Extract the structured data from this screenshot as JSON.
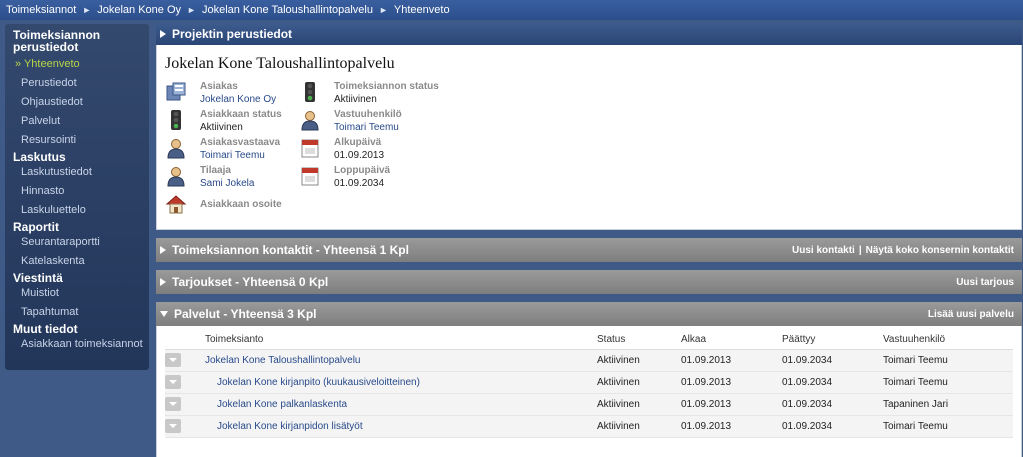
{
  "breadcrumb": [
    "Toimeksiannot",
    "Jokelan Kone Oy",
    "Jokelan Kone Taloushallintopalvelu",
    "Yhteenveto"
  ],
  "sidebar": {
    "sections": [
      {
        "title": "Toimeksiannon perustiedot",
        "items": [
          {
            "label": "» Yhteenveto",
            "active": true
          },
          {
            "label": "Perustiedot"
          },
          {
            "label": "Ohjaustiedot"
          },
          {
            "label": "Palvelut"
          },
          {
            "label": "Resursointi"
          }
        ]
      },
      {
        "title": "Laskutus",
        "items": [
          {
            "label": "Laskutustiedot"
          },
          {
            "label": "Hinnasto"
          },
          {
            "label": "Laskuluettelo"
          }
        ]
      },
      {
        "title": "Raportit",
        "items": [
          {
            "label": "Seurantaraportti"
          },
          {
            "label": "Katelaskenta"
          }
        ]
      },
      {
        "title": "Viestintä",
        "items": [
          {
            "label": "Muistiot"
          },
          {
            "label": "Tapahtumat"
          }
        ]
      },
      {
        "title": "Muut tiedot",
        "items": [
          {
            "label": "Asiakkaan toimeksiannot"
          }
        ]
      }
    ]
  },
  "project": {
    "header": "Projektin perustiedot",
    "title": "Jokelan Kone Taloushallintopalvelu",
    "left": [
      {
        "icon": "customer-icon",
        "label": "Asiakas",
        "value": "Jokelan Kone Oy",
        "link": true
      },
      {
        "icon": "traffic-light-icon",
        "label": "Asiakkaan status",
        "value": "Aktiivinen",
        "link": false
      },
      {
        "icon": "person-icon",
        "label": "Asiakasvastaava",
        "value": "Toimari Teemu",
        "link": true
      },
      {
        "icon": "person-icon",
        "label": "Tilaaja",
        "value": "Sami Jokela",
        "link": true
      },
      {
        "icon": "house-icon",
        "label": "Asiakkaan osoite",
        "value": "",
        "link": false
      }
    ],
    "right": [
      {
        "icon": "traffic-light-icon",
        "label": "Toimeksiannon status",
        "value": "Aktiivinen",
        "link": false
      },
      {
        "icon": "person-icon",
        "label": "Vastuuhenkilö",
        "value": "Toimari Teemu",
        "link": true
      },
      {
        "icon": "calendar-icon",
        "label": "Alkupäivä",
        "value": "01.09.2013",
        "link": false
      },
      {
        "icon": "calendar-icon",
        "label": "Loppupäivä",
        "value": "01.09.2034",
        "link": false
      }
    ]
  },
  "contacts": {
    "header": "Toimeksiannon kontaktit - Yhteensä 1 Kpl",
    "link1": "Uusi kontakti",
    "separator": "|",
    "link2": "Näytä koko konsernin kontaktit"
  },
  "offers": {
    "header": "Tarjoukset - Yhteensä 0 Kpl",
    "link": "Uusi tarjous"
  },
  "services": {
    "header": "Palvelut - Yhteensä 3 Kpl",
    "link": "Lisää uusi palvelu",
    "columns": [
      "Toimeksianto",
      "Status",
      "Alkaa",
      "Päättyy",
      "Vastuuhenkilö"
    ],
    "rows": [
      {
        "name": "Jokelan Kone Taloushallintopalvelu",
        "indent": false,
        "status": "Aktiivinen",
        "start": "01.09.2013",
        "end": "01.09.2034",
        "owner": "Toimari Teemu"
      },
      {
        "name": "Jokelan Kone kirjanpito (kuukausiveloitteinen)",
        "indent": true,
        "status": "Aktiivinen",
        "start": "01.09.2013",
        "end": "01.09.2034",
        "owner": "Toimari Teemu"
      },
      {
        "name": "Jokelan Kone palkanlaskenta",
        "indent": true,
        "status": "Aktiivinen",
        "start": "01.09.2013",
        "end": "01.09.2034",
        "owner": "Tapaninen Jari"
      },
      {
        "name": "Jokelan Kone kirjanpidon lisätyöt",
        "indent": true,
        "status": "Aktiivinen",
        "start": "01.09.2013",
        "end": "01.09.2034",
        "owner": "Toimari Teemu"
      }
    ]
  }
}
